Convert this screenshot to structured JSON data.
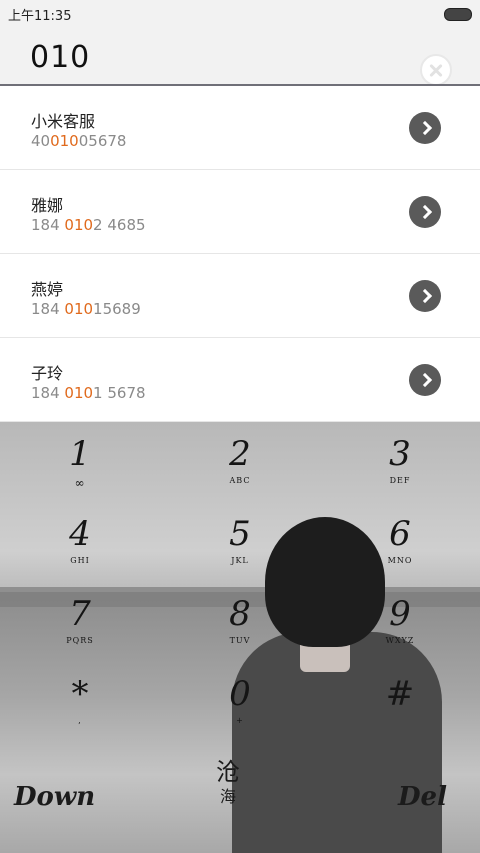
{
  "status_bar": {
    "time": "上午11:35"
  },
  "search": {
    "query": "010"
  },
  "contacts": [
    {
      "name": "小米客服",
      "pre": "40",
      "hl": "010",
      "post": "05678"
    },
    {
      "name": "雅娜",
      "pre": "184 ",
      "hl": "010",
      "post": "2 4685"
    },
    {
      "name": "燕婷",
      "pre": "184 ",
      "hl": "010",
      "post": "15689"
    },
    {
      "name": "子玲",
      "pre": "184 ",
      "hl": "010",
      "post": "1 5678"
    }
  ],
  "dialpad": {
    "keys": [
      {
        "digit": "1",
        "letters": "∞"
      },
      {
        "digit": "2",
        "letters": "ABC"
      },
      {
        "digit": "3",
        "letters": "DEF"
      },
      {
        "digit": "4",
        "letters": "GHI"
      },
      {
        "digit": "5",
        "letters": "JKL"
      },
      {
        "digit": "6",
        "letters": "MNO"
      },
      {
        "digit": "7",
        "letters": "PQRS"
      },
      {
        "digit": "8",
        "letters": "TUV"
      },
      {
        "digit": "9",
        "letters": "WXYZ"
      },
      {
        "digit": "*",
        "letters": ","
      },
      {
        "digit": "0",
        "letters": "+"
      },
      {
        "digit": "#",
        "letters": ""
      }
    ],
    "down_label": "Down",
    "del_label": "Del",
    "signature": {
      "line1": "沧",
      "line2": "海"
    }
  },
  "colors": {
    "highlight": "#e06a1d",
    "arrow_button": "#5a5a5a"
  }
}
